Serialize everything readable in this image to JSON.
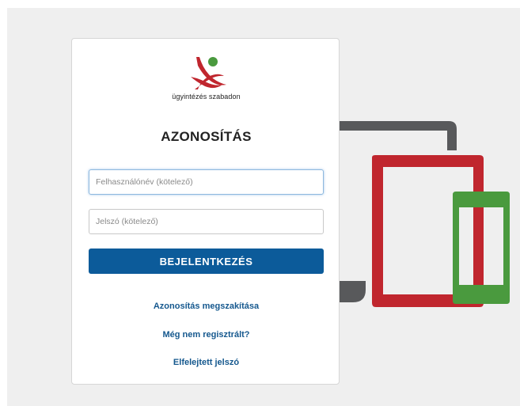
{
  "brand": {
    "tagline": "ügyintézés szabadon",
    "colors": {
      "red": "#c0262e",
      "green": "#4a9a3e",
      "dark": "#58595b"
    }
  },
  "login": {
    "title": "AZONOSÍTÁS",
    "username_placeholder": "Felhasználónév (kötelező)",
    "username_value": "",
    "password_placeholder": "Jelszó (kötelező)",
    "password_value": "",
    "submit_label": "BEJELENTKEZÉS",
    "accent_color": "#0c5b9a"
  },
  "links": {
    "cancel": "Azonosítás megszakítása",
    "register": "Még nem regisztrált?",
    "forgot_password": "Elfelejtett jelszó"
  },
  "illustration": {
    "devices": [
      "laptop-icon",
      "tablet-icon",
      "phone-icon"
    ]
  }
}
